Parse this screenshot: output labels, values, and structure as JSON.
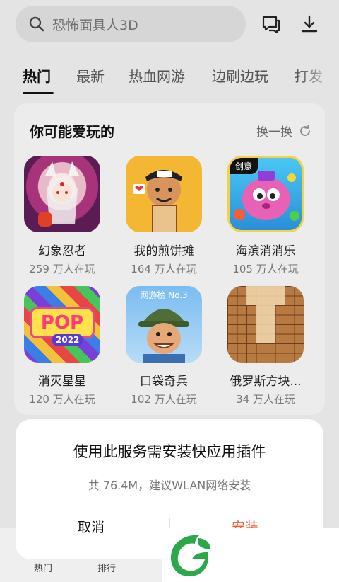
{
  "search": {
    "placeholder": "恐怖面具人3D"
  },
  "icons": {
    "search": "search-icon",
    "message": "message-icon",
    "download": "download-icon",
    "refresh": "refresh-icon"
  },
  "tabs": [
    {
      "label": "热门",
      "active": true
    },
    {
      "label": "最新"
    },
    {
      "label": "热血网游"
    },
    {
      "label": "边刷边玩"
    },
    {
      "label": "打发"
    }
  ],
  "card": {
    "title": "你可能爱玩的",
    "refresh_label": "换一换",
    "games": [
      {
        "name": "幻象忍者",
        "players": "259 万人在玩"
      },
      {
        "name": "我的煎饼摊",
        "players": "164 万人在玩"
      },
      {
        "name": "海滨消消乐",
        "players": "105 万人在玩",
        "badge": "创意"
      },
      {
        "name": "消灭星星",
        "players": "120 万人在玩",
        "art_text": "POP",
        "art_year": "2022"
      },
      {
        "name": "口袋奇兵",
        "players": "102 万人在玩",
        "badge": "网游榜 No.3"
      },
      {
        "name": "俄罗斯方块...",
        "players": "34 万人在玩"
      }
    ]
  },
  "bottom_nav": {
    "items": [
      {
        "label": "热门"
      },
      {
        "label": "排行"
      }
    ]
  },
  "dialog": {
    "title": "使用此服务需安装快应用插件",
    "subtitle": "共 76.4M，建议WLAN网络安装",
    "cancel": "取消",
    "install": "安装"
  },
  "colors": {
    "accent": "#ef5a28",
    "logo": "#2aa84a"
  }
}
